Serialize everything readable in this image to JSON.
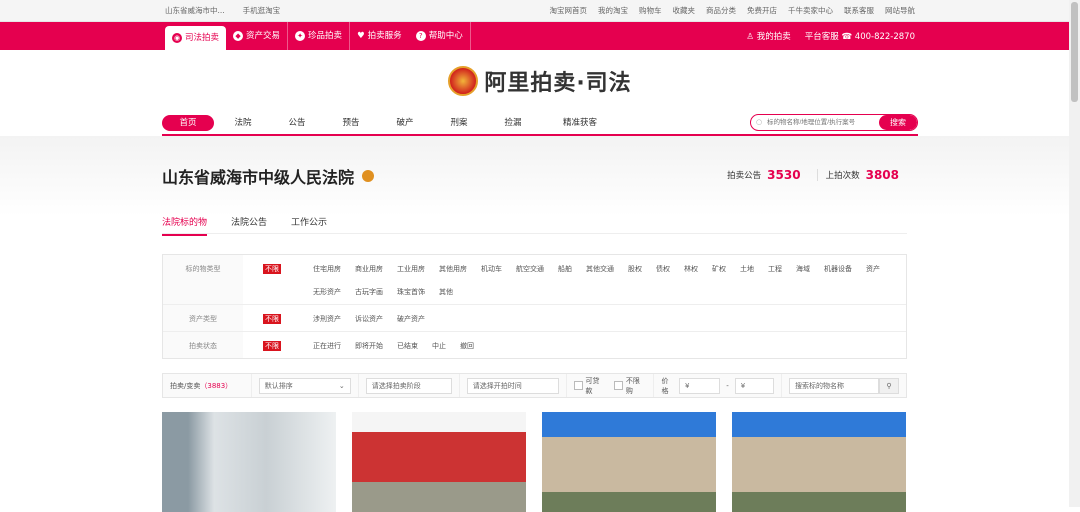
{
  "topbar": {
    "location": "山东省威海市中...",
    "mobile": "手机逛淘宝",
    "links": [
      "淘宝网首页",
      "我的淘宝",
      "购物车",
      "收藏夹",
      "商品分类",
      "免费开店",
      "千牛卖家中心",
      "联系客服",
      "网站导航"
    ]
  },
  "nav": {
    "items": [
      "司法拍卖",
      "资产交易",
      "珍品拍卖",
      "拍卖服务",
      "帮助中心"
    ],
    "my": "我的拍卖",
    "service": "平台客服",
    "phone": "400-822-2870"
  },
  "logo": {
    "text": "阿里拍卖·司法"
  },
  "mainnav": {
    "items": [
      "首页",
      "法院",
      "公告",
      "预告",
      "破产",
      "刑案",
      "捡漏",
      "精准获客"
    ],
    "search_placeholder": "标的物名称/地理位置/执行案号",
    "search_button": "搜索"
  },
  "court": {
    "name": "山东省威海市中级人民法院",
    "notice_label": "拍卖公告",
    "notice_count": "3530",
    "times_label": "上拍次数",
    "times_count": "3808"
  },
  "tabs": [
    "法院标的物",
    "法院公告",
    "工作公示"
  ],
  "filters": [
    {
      "label": "标的物类型",
      "all": "不限",
      "options": [
        "住宅用房",
        "商业用房",
        "工业用房",
        "其他用房",
        "机动车",
        "航空交通",
        "船舶",
        "其他交通",
        "股权",
        "债权",
        "林权",
        "矿权",
        "土地",
        "工程",
        "海域",
        "机器设备",
        "资产",
        "无形资产",
        "古玩字画",
        "珠宝首饰",
        "其他"
      ]
    },
    {
      "label": "资产类型",
      "all": "不限",
      "options": [
        "涉刑资产",
        "诉讼资产",
        "破产资产"
      ]
    },
    {
      "label": "拍卖状态",
      "all": "不限",
      "options": [
        "正在进行",
        "即将开始",
        "已结束",
        "中止",
        "撤回"
      ]
    }
  ],
  "toolbar": {
    "count_label": "拍卖/变卖",
    "count": "（3883）",
    "sort": "默认排序",
    "stage": "请选择拍卖阶段",
    "time": "请选择开拍时间",
    "loan": "可贷款",
    "nolimit": "不限购",
    "price": "价格",
    "yen": "¥",
    "dash": "-",
    "search_placeholder": "搜索标的物名称"
  }
}
